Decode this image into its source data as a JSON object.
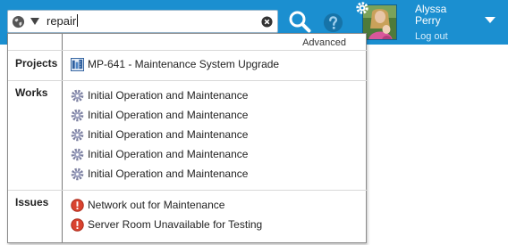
{
  "search": {
    "query": "repair"
  },
  "user": {
    "name": "Alyssa Perry",
    "logout_label": "Log out"
  },
  "dropdown": {
    "advanced_label": "Advanced",
    "sections": {
      "projects": {
        "title": "Projects",
        "items": [
          "MP-641 - Maintenance System Upgrade"
        ]
      },
      "works": {
        "title": "Works",
        "items": [
          "Initial Operation and Maintenance",
          "Initial Operation and Maintenance",
          "Initial Operation and Maintenance",
          "Initial Operation and Maintenance",
          "Initial Operation and Maintenance"
        ]
      },
      "issues": {
        "title": "Issues",
        "items": [
          "Network out for Maintenance",
          "Server Room Unavailable for Testing"
        ]
      }
    }
  },
  "icons": {
    "globe": "globe-icon",
    "scope": "caret-down-icon",
    "clear": "clear-icon",
    "search": "search-icon",
    "help": "help-icon",
    "gear": "gear-icon",
    "project": "project-icon",
    "work": "work-gear-icon",
    "issue": "issue-alert-icon"
  },
  "colors": {
    "topbar": "#1b8fd0",
    "issue": "#d9432f",
    "help": "#1673a8"
  }
}
